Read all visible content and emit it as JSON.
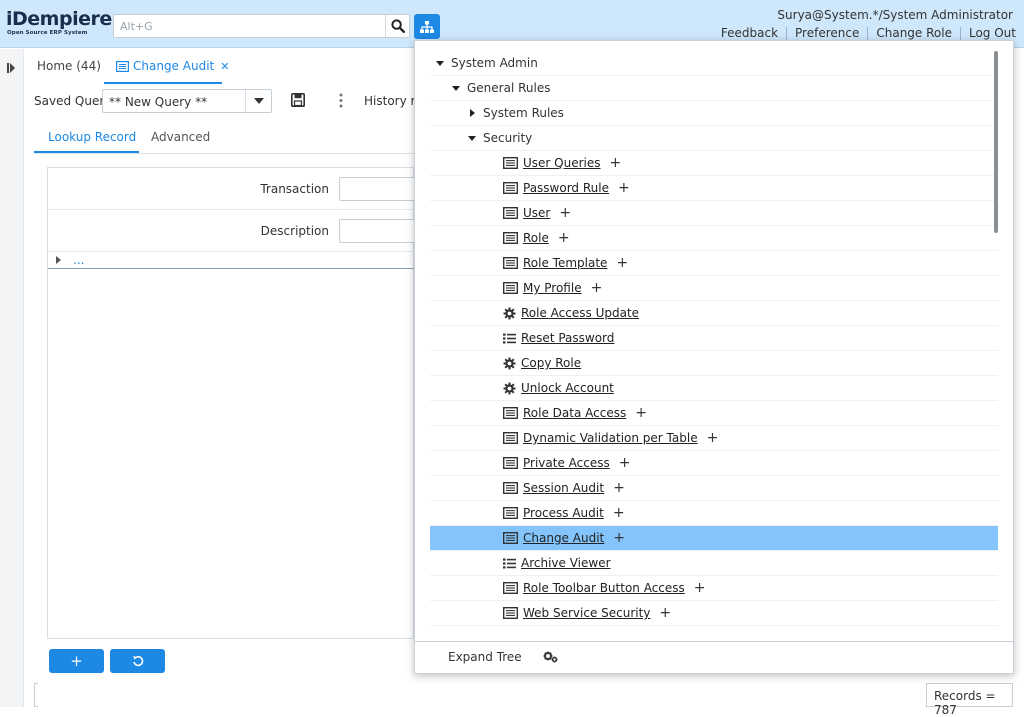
{
  "header": {
    "logo_word": "iDempiere",
    "logo_tag": "Open Source ERP System",
    "search_placeholder": "Alt+G",
    "user": "Surya@System.*/System Administrator",
    "links": [
      "Feedback",
      "Preference",
      "Change Role",
      "Log Out"
    ]
  },
  "window_tabs": {
    "home": "Home (44)",
    "active": "Change Audit",
    "close_glyph": "✕"
  },
  "query": {
    "label": "Saved Query",
    "value": "** New Query **",
    "history": "History re"
  },
  "find_tabs": [
    "Lookup Record",
    "Advanced"
  ],
  "form": {
    "fields": [
      {
        "label": "Transaction",
        "value": ""
      },
      {
        "label": "Description",
        "value": ""
      }
    ],
    "more_text": "..."
  },
  "buttons": {
    "add": "+",
    "reset": "⟲"
  },
  "status": {
    "records": "Records = 787"
  },
  "menu": {
    "items": [
      {
        "label": "System Admin",
        "level": 0,
        "type": "folder",
        "expanded": true
      },
      {
        "label": "General Rules",
        "level": 1,
        "type": "folder",
        "expanded": true
      },
      {
        "label": "System Rules",
        "level": 2,
        "type": "folder",
        "expanded": false
      },
      {
        "label": "Security",
        "level": 2,
        "type": "folder",
        "expanded": true
      },
      {
        "label": "User Queries",
        "level": 3,
        "type": "window",
        "plus": true
      },
      {
        "label": "Password Rule",
        "level": 3,
        "type": "window",
        "plus": true
      },
      {
        "label": "User",
        "level": 3,
        "type": "window",
        "plus": true
      },
      {
        "label": "Role",
        "level": 3,
        "type": "window",
        "plus": true
      },
      {
        "label": "Role Template",
        "level": 3,
        "type": "window",
        "plus": true
      },
      {
        "label": "My Profile",
        "level": 3,
        "type": "window",
        "plus": true
      },
      {
        "label": "Role Access Update",
        "level": 3,
        "type": "process",
        "plus": false
      },
      {
        "label": "Reset Password",
        "level": 3,
        "type": "list",
        "plus": false
      },
      {
        "label": "Copy Role",
        "level": 3,
        "type": "process",
        "plus": false
      },
      {
        "label": "Unlock Account",
        "level": 3,
        "type": "process",
        "plus": false
      },
      {
        "label": "Role Data Access",
        "level": 3,
        "type": "window",
        "plus": true
      },
      {
        "label": "Dynamic Validation per Table",
        "level": 3,
        "type": "window",
        "plus": true
      },
      {
        "label": "Private Access",
        "level": 3,
        "type": "window",
        "plus": true
      },
      {
        "label": "Session Audit",
        "level": 3,
        "type": "window",
        "plus": true
      },
      {
        "label": "Process Audit",
        "level": 3,
        "type": "window",
        "plus": true
      },
      {
        "label": "Change Audit",
        "level": 3,
        "type": "window",
        "plus": true,
        "selected": true
      },
      {
        "label": "Archive Viewer",
        "level": 3,
        "type": "list",
        "plus": false
      },
      {
        "label": "Role Toolbar Button Access",
        "level": 3,
        "type": "window",
        "plus": true
      },
      {
        "label": "Web Service Security",
        "level": 3,
        "type": "window",
        "plus": true
      }
    ],
    "footer": {
      "expand_tree": "Expand Tree"
    }
  },
  "colors": {
    "accent": "#1e88e5",
    "header_bg": "#cfe7fb",
    "selected_row": "#82c4fb"
  }
}
